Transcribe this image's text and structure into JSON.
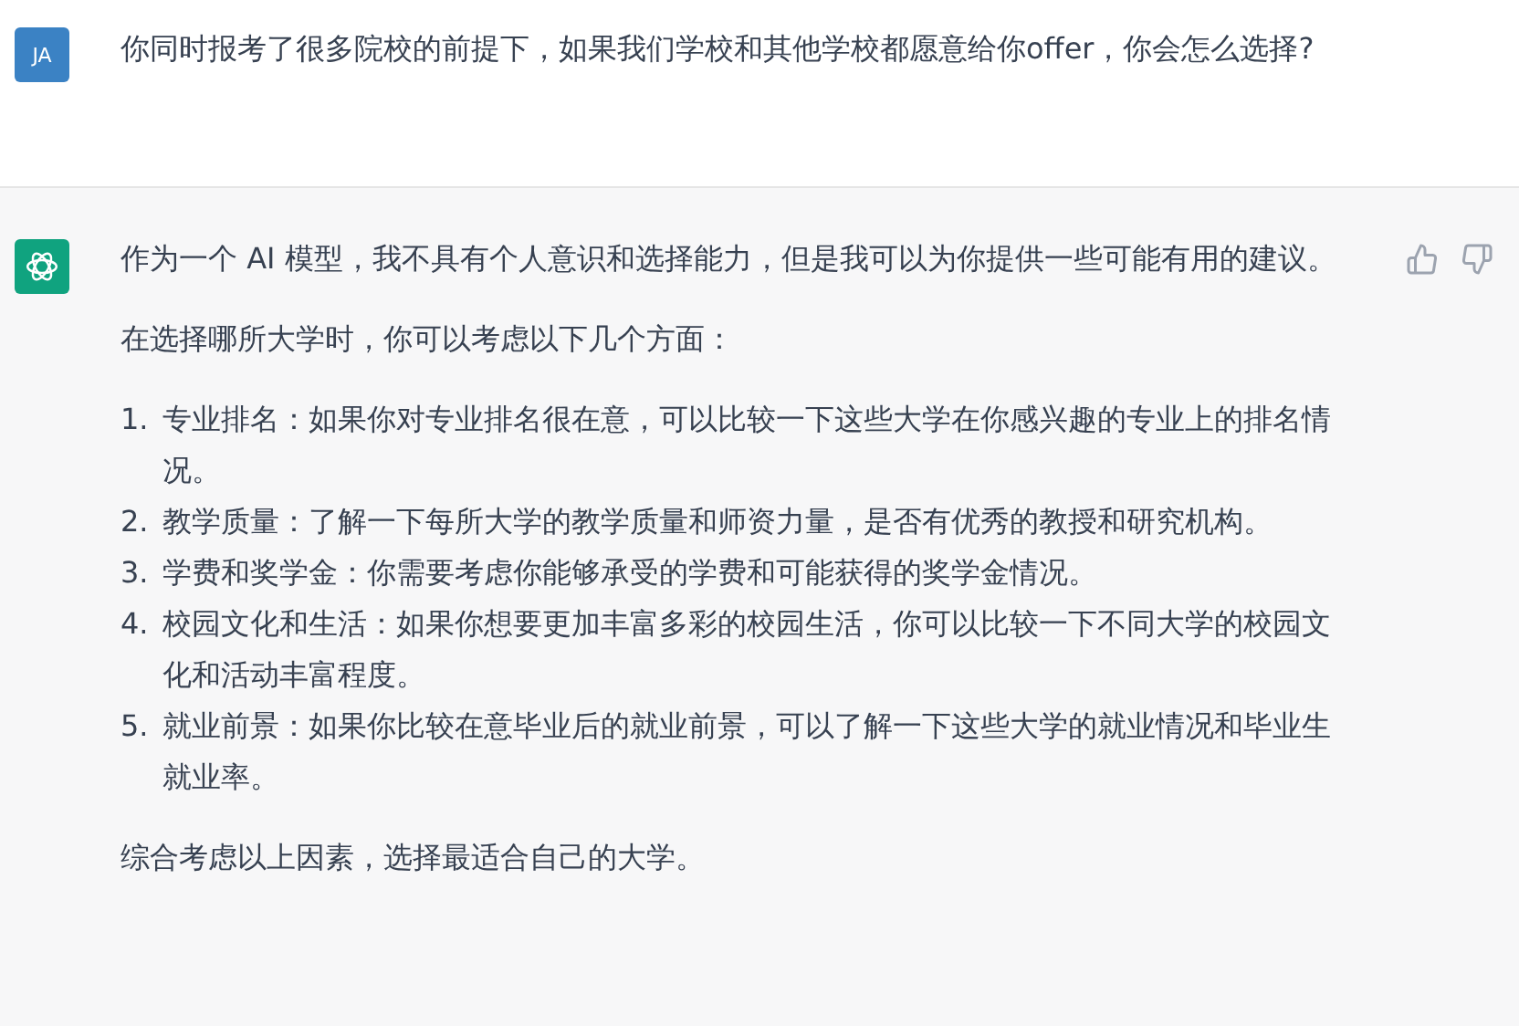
{
  "messages": [
    {
      "kind": "user",
      "avatar": "JA",
      "paragraphs": [
        "你同时报考了很多院校的前提下，如果我们学校和其他学校都愿意给你offer，你会怎么选择?"
      ]
    },
    {
      "kind": "assistant",
      "paragraphs": [
        "作为一个 AI 模型，我不具有个人意识和选择能力，但是我可以为你提供一些可能有用的建议。",
        "在选择哪所大学时，你可以考虑以下几个方面："
      ],
      "list": [
        {
          "number": "1.",
          "text": "专业排名：如果你对专业排名很在意，可以比较一下这些大学在你感兴趣的专业上的排名情况。"
        },
        {
          "number": "2.",
          "text": "教学质量：了解一下每所大学的教学质量和师资力量，是否有优秀的教授和研究机构。"
        },
        {
          "number": "3.",
          "text": "学费和奖学金：你需要考虑你能够承受的学费和可能获得的奖学金情况。"
        },
        {
          "number": "4.",
          "text": "校园文化和生活：如果你想要更加丰富多彩的校园生活，你可以比较一下不同大学的校园文化和活动丰富程度。"
        },
        {
          "number": "5.",
          "text": "就业前景：如果你比较在意毕业后的就业前景，可以了解一下这些大学的就业情况和毕业生就业率。"
        }
      ],
      "closing": "综合考虑以上因素，选择最适合自己的大学。"
    }
  ]
}
